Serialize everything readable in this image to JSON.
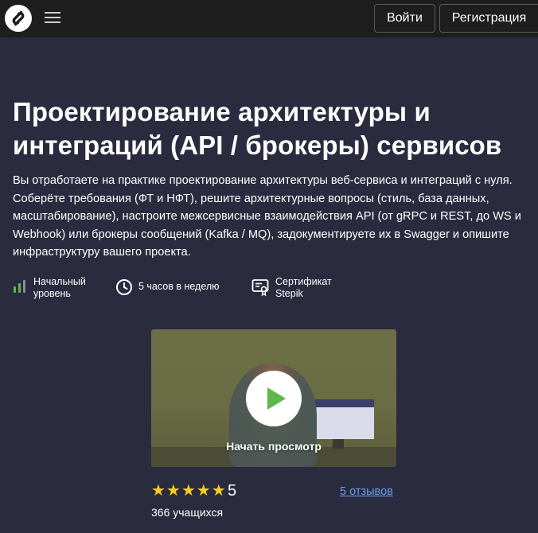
{
  "header": {
    "login_label": "Войти",
    "register_label": "Регистрация",
    "logo_icon": "stepik-logo-icon",
    "menu_icon": "hamburger-menu-icon"
  },
  "course": {
    "title": "Проектирование архитектуры и интеграций (API / брокеры) сервисов",
    "description": "Вы отработаете на практике проектирование архитектуры веб-сервиса и интеграций с нуля. Соберёте требования (ФТ и НФТ), решите архитектурные вопросы (стиль, база данных, масштабирование), настроите межсервисные взаимодействия API (от gRPC и REST, до WS и Webhook) или брокеры сообщений (Kafka / MQ), задокументируете их в Swagger и опишите инфраструктуру вашего проекта.",
    "features": {
      "level_line1": "Начальный",
      "level_line2": "уровень",
      "time": "5 часов в неделю",
      "cert_line1": "Сертификат",
      "cert_line2": "Stepik"
    },
    "video": {
      "caption": "Начать просмотр",
      "play_icon": "play-icon"
    },
    "rating": {
      "stars": "★★★★★",
      "value": "5",
      "reviews_label": "5 отзывов",
      "students": "366 учащихся"
    }
  },
  "colors": {
    "background": "#2b2b3f",
    "topbar": "#1e1e1e",
    "star": "#f5cf1a",
    "link": "#6b9dee",
    "play": "#5fb848",
    "level_bar": "#5fb848"
  }
}
